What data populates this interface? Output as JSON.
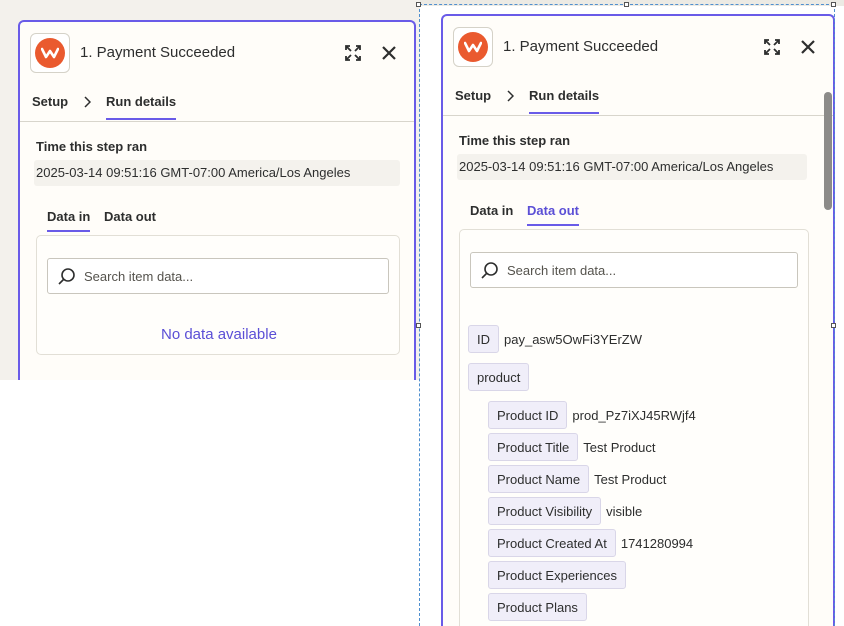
{
  "left_panel": {
    "title": "1. Payment Succeeded",
    "tabs": {
      "setup": "Setup",
      "run_details": "Run details"
    },
    "time_label": "Time this step ran",
    "time_value": "2025-03-14 09:51:16 GMT-07:00 America/Los Angeles",
    "data_tabs": {
      "data_in": "Data in",
      "data_out": "Data out",
      "active": "Data in"
    },
    "search_placeholder": "Search item data...",
    "empty_message": "No data available"
  },
  "right_panel": {
    "title": "1. Payment Succeeded",
    "tabs": {
      "setup": "Setup",
      "run_details": "Run details"
    },
    "time_label": "Time this step ran",
    "time_value": "2025-03-14 09:51:16 GMT-07:00 America/Los Angeles",
    "data_tabs": {
      "data_in": "Data in",
      "data_out": "Data out",
      "active": "Data out"
    },
    "search_placeholder": "Search item data...",
    "fields": [
      {
        "key": "ID",
        "value": "pay_asw5OwFi3YErZW"
      },
      {
        "key": "product",
        "value": ""
      },
      {
        "key": "Product ID",
        "value": "prod_Pz7iXJ45RWjf4"
      },
      {
        "key": "Product Title",
        "value": "Test Product"
      },
      {
        "key": "Product Name",
        "value": "Test Product"
      },
      {
        "key": "Product Visibility",
        "value": "visible"
      },
      {
        "key": "Product Created At",
        "value": "1741280994"
      },
      {
        "key": "Product Experiences",
        "value": ""
      },
      {
        "key": "Product Plans",
        "value": ""
      }
    ]
  },
  "colors": {
    "accent": "#695be8",
    "logo": "#ea5a2f"
  },
  "icons": {
    "app": "app-logo-icon",
    "expand": "expand-icon",
    "close": "close-icon",
    "chevron": "chevron-right-icon",
    "search": "search-icon"
  }
}
